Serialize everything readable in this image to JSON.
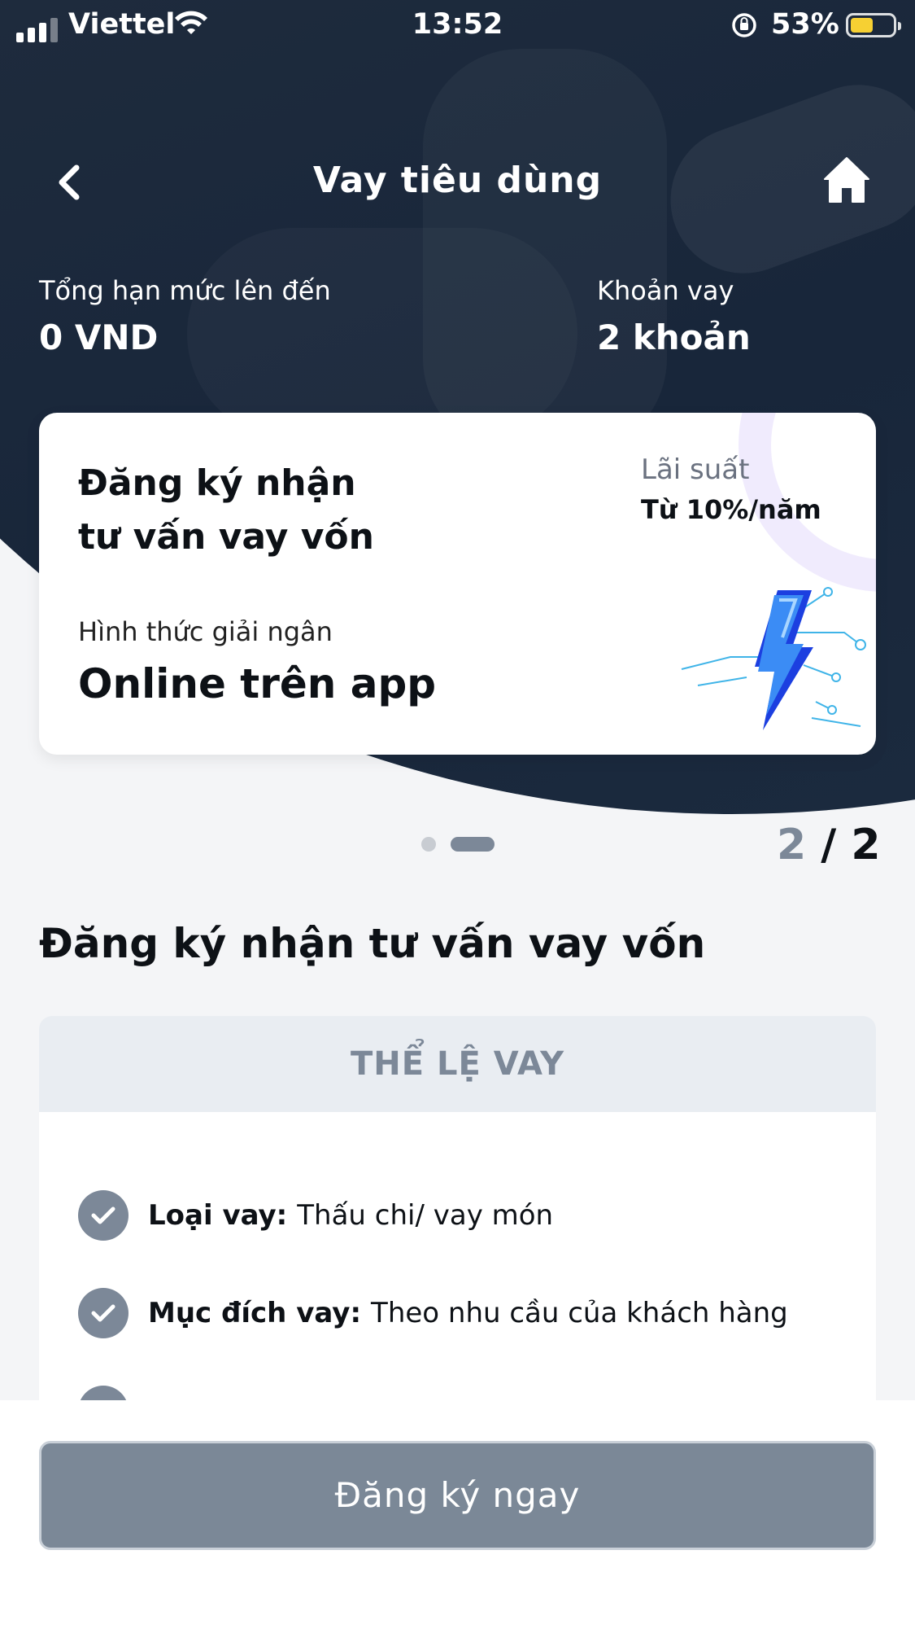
{
  "status_bar": {
    "carrier": "Viettel",
    "time": "13:52",
    "battery_percent": "53%",
    "battery_level": 0.53
  },
  "nav": {
    "title": "Vay tiêu dùng",
    "back_icon": "chevron-left-icon",
    "home_icon": "home-icon"
  },
  "summary": {
    "limit_label": "Tổng hạn mức lên đến",
    "limit_value": "0 VND",
    "loans_label": "Khoản vay",
    "loans_value": "2 khoản"
  },
  "card": {
    "title_line1": "Đăng ký nhận",
    "title_line2": "tư vấn vay vốn",
    "rate_label": "Lãi suất",
    "rate_value": "Từ  10%/năm",
    "disbursement_label": "Hình thức giải ngân",
    "disbursement_value": "Online trên app",
    "illustration": "lightning-bolt-icon"
  },
  "pager": {
    "current": "2",
    "separator": " / ",
    "total": "2"
  },
  "section": {
    "title": "Đăng ký nhận tư vấn vay vốn"
  },
  "rules": {
    "header": "THỂ LỆ VAY",
    "items": [
      {
        "label": "Loại vay:",
        "value": "Thấu chi/ vay món"
      },
      {
        "label": "Mục đích vay:",
        "value": "Theo nhu cầu của khách hàng"
      }
    ]
  },
  "cta": {
    "label": "Đăng ký ngay"
  },
  "colors": {
    "header_bg": "#1b2a3d",
    "accent_gray": "#7b8897",
    "card_bg": "#ffffff"
  }
}
